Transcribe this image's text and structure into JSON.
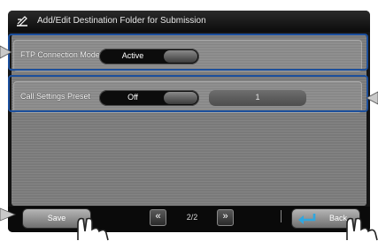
{
  "window": {
    "title": "Add/Edit Destination Folder for Submission",
    "title_icon": "folder-edit-icon"
  },
  "settings": {
    "ftp_connection_mode": {
      "label": "FTP Connection Mode",
      "value": "Active"
    },
    "call_settings_preset": {
      "label": "Call Settings Preset",
      "value": "Off",
      "preset_number": "1"
    }
  },
  "footer": {
    "save_label": "Save",
    "prev_icon": "double-chevron-left-icon",
    "next_icon": "double-chevron-right-icon",
    "page_indicator": "2/2",
    "back_label": "Back",
    "back_icon": "return-arrow-icon"
  },
  "colors": {
    "highlight": "#1c4f9c",
    "back_arrow": "#2fa7e0"
  }
}
